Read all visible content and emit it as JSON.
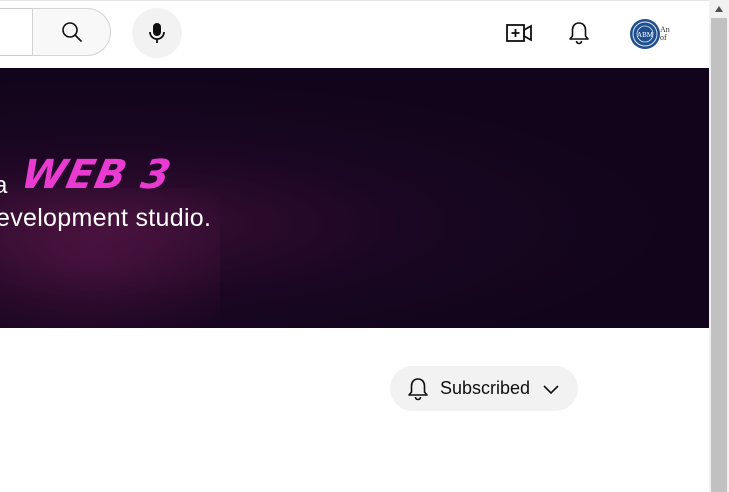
{
  "header": {
    "icons": {
      "search": "search-icon",
      "mic": "microphone-icon",
      "create": "video-plus-icon",
      "notifications": "bell-icon",
      "avatar": "channel-avatar"
    },
    "avatar_text": "An of"
  },
  "banner": {
    "line1_prefix": "a",
    "highlight": "WEB 3",
    "line2": "evelopment studio.",
    "colors": {
      "highlight": "#e93bd2",
      "background": "#10051a"
    }
  },
  "subscribe": {
    "label": "Subscribed",
    "icons": {
      "bell": "bell-icon",
      "chevron": "chevron-down-icon"
    }
  },
  "scrollbar": {
    "up_arrow": "▲"
  }
}
